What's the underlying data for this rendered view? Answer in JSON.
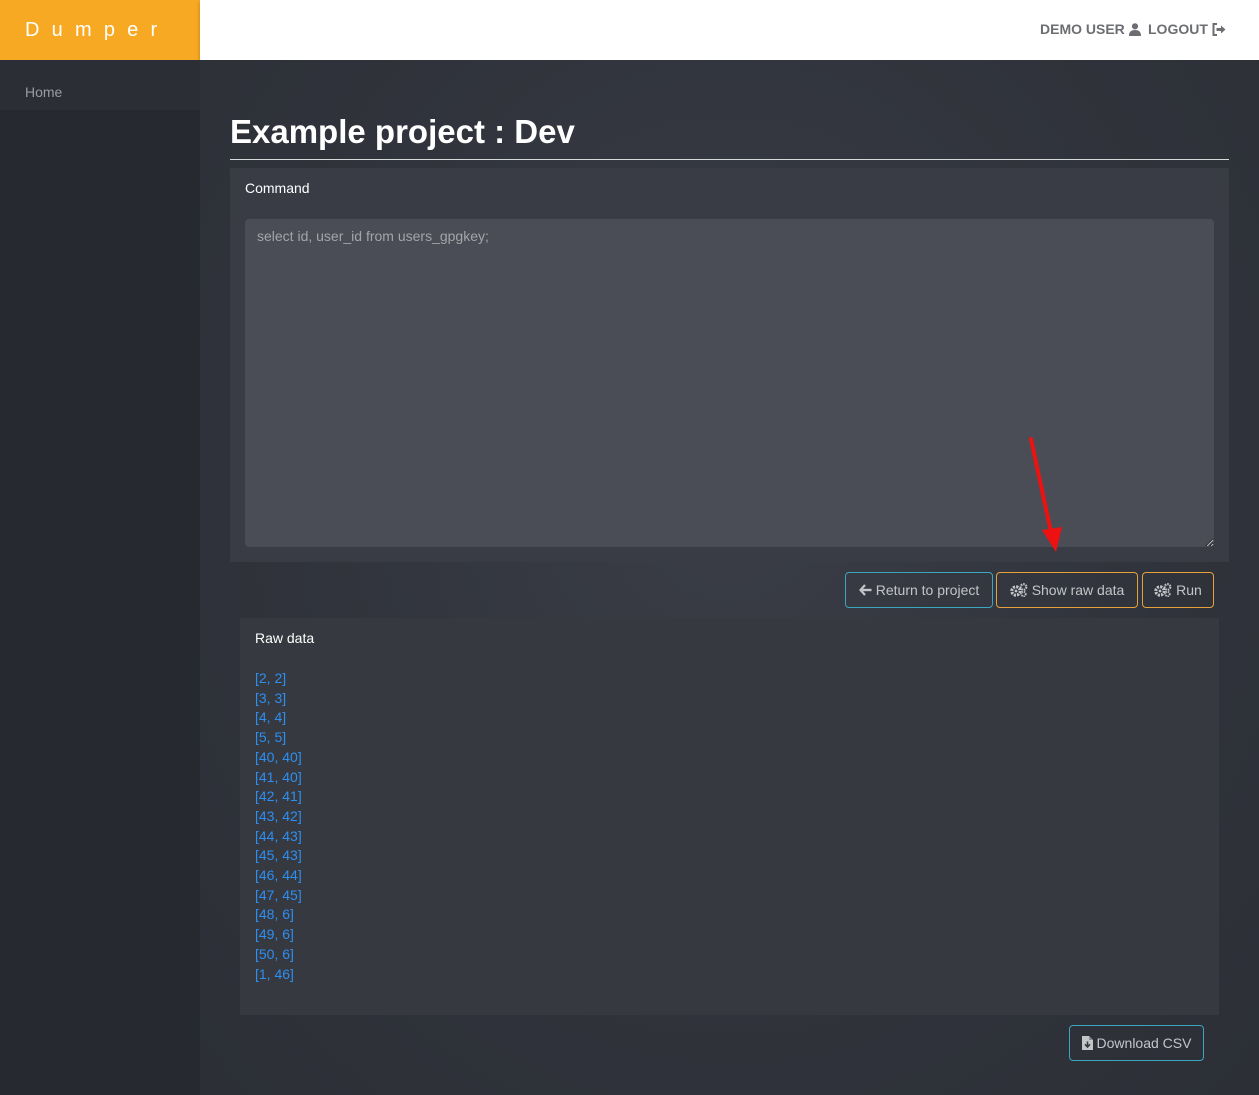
{
  "brand": {
    "name": "Dumper",
    "color": "#f8a923"
  },
  "topbar": {
    "user_label": "DEMO USER",
    "user_icon": "user-icon",
    "logout_label": "LOGOUT",
    "logout_icon": "sign-out-icon"
  },
  "sidebar": {
    "items": [
      {
        "label": "Home"
      }
    ]
  },
  "page": {
    "title": "Example project : Dev"
  },
  "command": {
    "label": "Command",
    "placeholder": "select id, user_id from users_gpgkey;"
  },
  "actions": {
    "return_label": "Return to project",
    "return_icon": "arrow-left-icon",
    "show_raw_label": "Show raw data",
    "show_raw_icon": "gears-icon",
    "run_label": "Run",
    "run_icon": "gears-icon"
  },
  "raw_data": {
    "label": "Raw data",
    "rows": [
      "[2, 2]",
      "[3, 3]",
      "[4, 4]",
      "[5, 5]",
      "[40, 40]",
      "[41, 40]",
      "[42, 41]",
      "[43, 42]",
      "[44, 43]",
      "[45, 43]",
      "[46, 44]",
      "[47, 45]",
      "[48, 6]",
      "[49, 6]",
      "[50, 6]",
      "[1, 46]"
    ]
  },
  "download": {
    "label": "Download CSV",
    "icon": "file-download-icon"
  },
  "annotation": {
    "arrow_color": "#ee1111"
  }
}
